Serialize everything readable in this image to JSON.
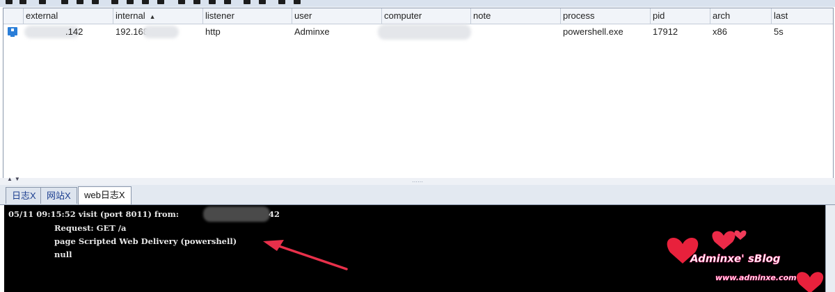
{
  "table": {
    "columns": [
      {
        "key": "external",
        "label": "external"
      },
      {
        "key": "internal",
        "label": "internal",
        "sorted": "ascending"
      },
      {
        "key": "listener",
        "label": "listener"
      },
      {
        "key": "user",
        "label": "user"
      },
      {
        "key": "computer",
        "label": "computer"
      },
      {
        "key": "note",
        "label": "note"
      },
      {
        "key": "process",
        "label": "process"
      },
      {
        "key": "pid",
        "label": "pid"
      },
      {
        "key": "arch",
        "label": "arch"
      },
      {
        "key": "last",
        "label": "last"
      }
    ],
    "rows": [
      {
        "icon": "windows-host-icon",
        "external": ".142",
        "internal": "192.168",
        "listener": "http",
        "user": "Adminxe",
        "computer": "",
        "note": "",
        "process": "powershell.exe",
        "pid": "17912",
        "arch": "x86",
        "last": "5s"
      }
    ]
  },
  "tabs": [
    {
      "label": "日志X",
      "active": false
    },
    {
      "label": "网站X",
      "active": false
    },
    {
      "label": "web日志X",
      "active": true
    }
  ],
  "console": {
    "lines": [
      "05/11 09:15:52 visit (port 8011) from:",
      "Request: GET /a",
      "page Scripted Web Delivery (powershell)",
      "null"
    ],
    "from_suffix": "42"
  },
  "watermark": {
    "title": "Adminxe' sBlog",
    "url": "www.adminxe.com"
  },
  "colors": {
    "header_bg": "#f1f4f9",
    "console_bg": "#000000",
    "arrow": "#e8304a",
    "heart": "#e8213c",
    "tab_text": "#1a3d8f"
  }
}
